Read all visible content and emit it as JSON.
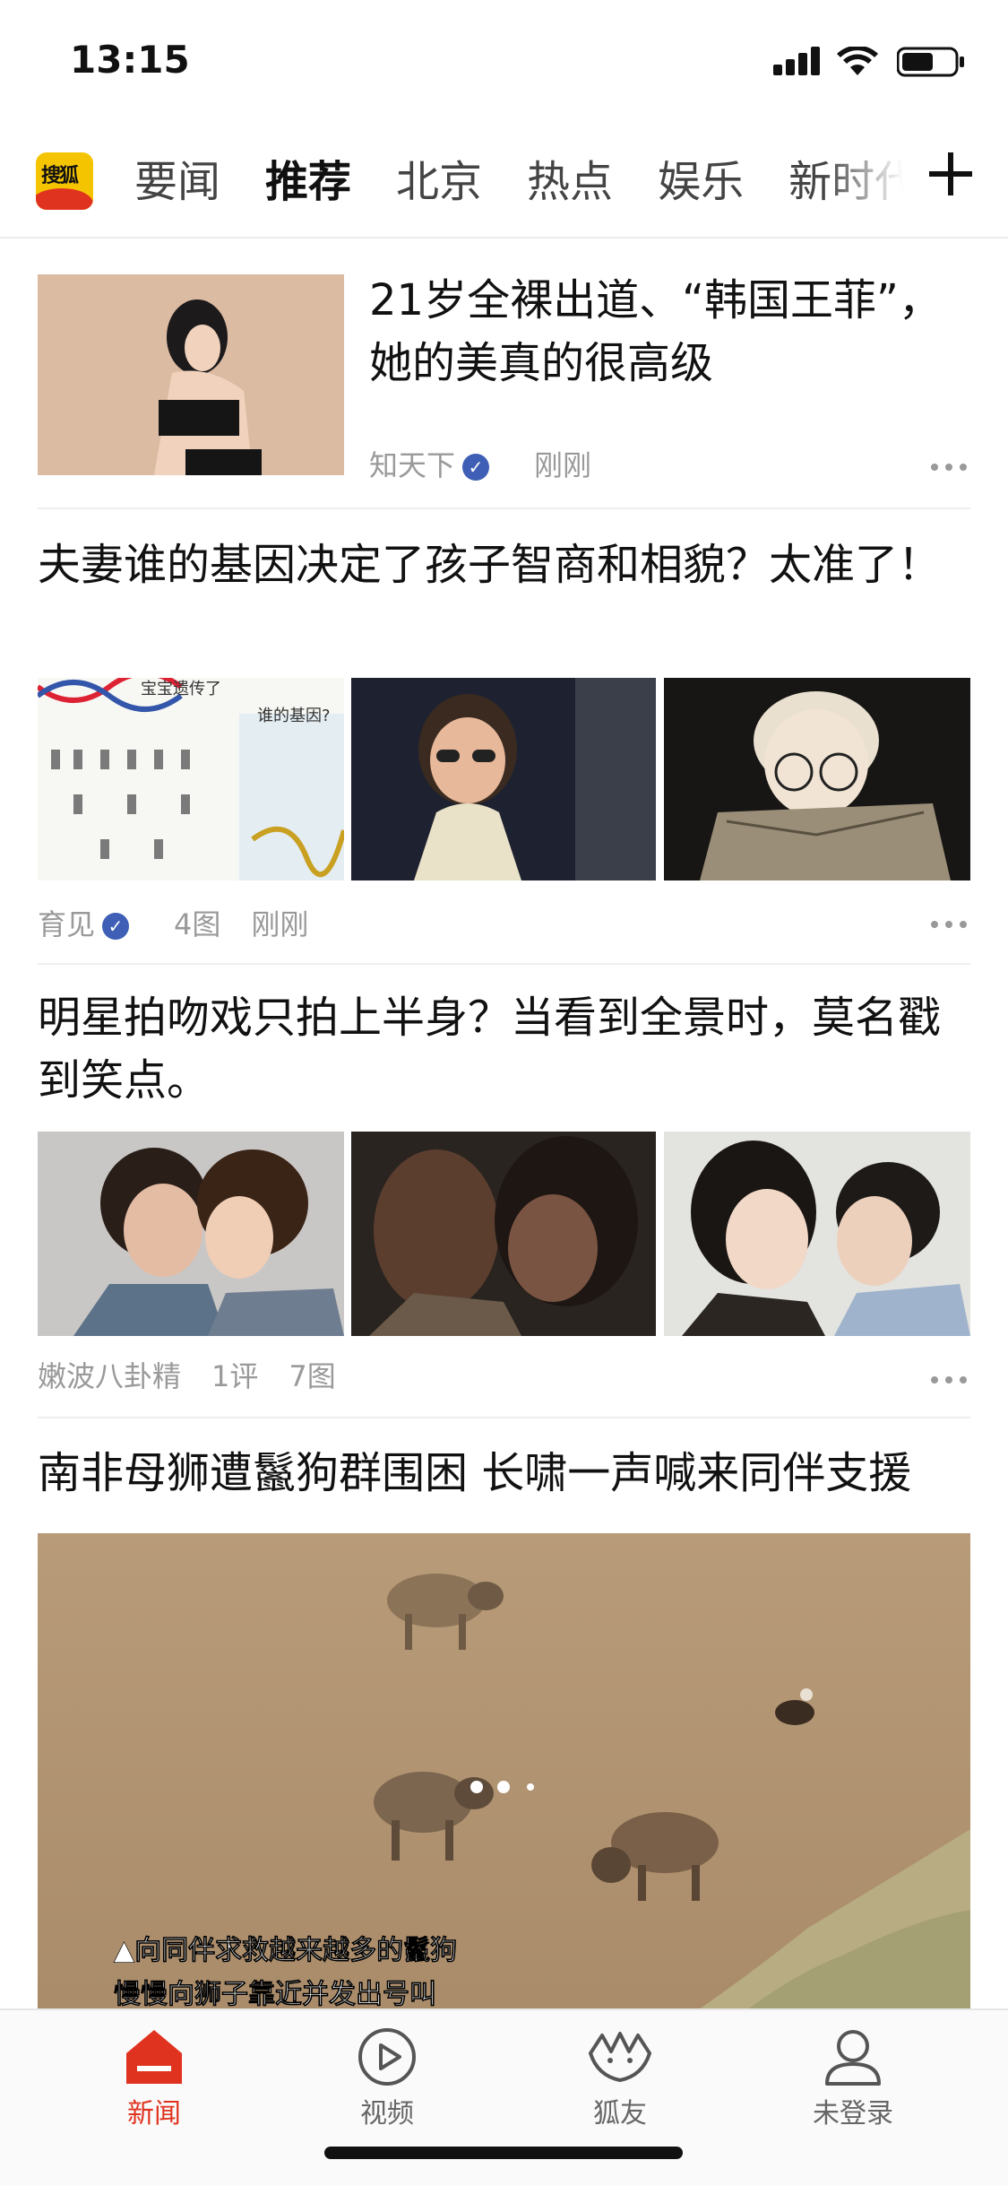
{
  "status_bar": {
    "time": "13:15"
  },
  "app": {
    "logo_text": "搜狐"
  },
  "channels": {
    "tabs": [
      "要闻",
      "推荐",
      "北京",
      "热点",
      "娱乐",
      "新时代"
    ],
    "active": "推荐"
  },
  "feed": [
    {
      "title": "21岁全裸出道、“韩国王菲”，她的美真的很高级",
      "source": "知天下",
      "verified": true,
      "time": "刚刚"
    },
    {
      "title": "夫妻谁的基因决定了孩子智商和相貌？太准了！",
      "image_text_1": "宝宝遗传了",
      "image_text_2": "谁的基因?",
      "source": "育见",
      "verified": true,
      "image_count": "4图",
      "time": "刚刚"
    },
    {
      "title": "明星拍吻戏只拍上半身？当看到全景时，莫名戳到笑点。",
      "source": "嫩波八卦精",
      "comments": "1评",
      "image_count": "7图"
    },
    {
      "title": "南非母狮遭鬣狗群围困 长啸一声喊来同伴支援",
      "caption_line_1": "▲向同伴求救越来越多的鬣狗",
      "caption_line_2": "慢慢向狮子靠近并发出号叫"
    }
  ],
  "bottom_nav": [
    {
      "label": "新闻",
      "icon": "home-icon",
      "active": true
    },
    {
      "label": "视频",
      "icon": "play-icon",
      "active": false
    },
    {
      "label": "狐友",
      "icon": "fox-friends-icon",
      "active": false
    },
    {
      "label": "未登录",
      "icon": "user-icon",
      "active": false
    }
  ],
  "colors": {
    "accent": "#e0331f",
    "verified_badge": "#3e5fb5",
    "logo_bg": "#f5c400"
  }
}
